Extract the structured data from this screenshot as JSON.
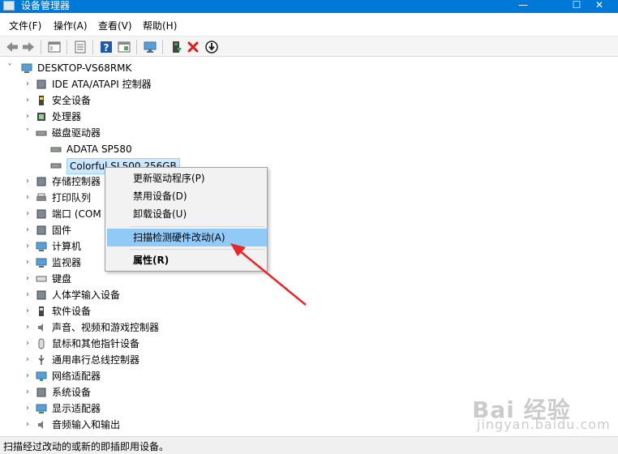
{
  "window": {
    "title": "设备管理器",
    "minimize": "—",
    "maximize": "☐",
    "close": "✕"
  },
  "menu": [
    "文件(F)",
    "操作(A)",
    "查看(V)",
    "帮助(H)"
  ],
  "toolbar_icons": [
    "back-icon",
    "forward-icon",
    "properties-panel-icon",
    "details-icon",
    "help-icon",
    "show-hidden-icon",
    "monitor-icon",
    "add-driver-icon",
    "uninstall-icon",
    "update-driver-icon"
  ],
  "tree": {
    "root": "DESKTOP-VS68RMK",
    "items": [
      {
        "label": "IDE ATA/ATAPI 控制器",
        "icon": "ide-controller-icon",
        "expanded": false
      },
      {
        "label": "安全设备",
        "icon": "security-device-icon",
        "expanded": false
      },
      {
        "label": "处理器",
        "icon": "processor-icon",
        "expanded": false
      },
      {
        "label": "磁盘驱动器",
        "icon": "disk-drive-icon",
        "expanded": true
      },
      {
        "label": "ADATA SP580",
        "icon": "disk-icon",
        "child": true
      },
      {
        "label": "Colorful SL500 256GB",
        "icon": "disk-icon",
        "child": true,
        "selected": true
      },
      {
        "label": "存储控制器",
        "icon": "storage-controller-icon",
        "expanded": false
      },
      {
        "label": "打印队列",
        "icon": "printer-icon",
        "expanded": false
      },
      {
        "label": "端口 (COM",
        "icon": "port-icon",
        "expanded": false
      },
      {
        "label": "固件",
        "icon": "firmware-icon",
        "expanded": false
      },
      {
        "label": "计算机",
        "icon": "computer-icon",
        "expanded": false
      },
      {
        "label": "监视器",
        "icon": "monitor-icon",
        "expanded": false
      },
      {
        "label": "键盘",
        "icon": "keyboard-icon",
        "expanded": false
      },
      {
        "label": "人体学输入设备",
        "icon": "hid-icon",
        "expanded": false
      },
      {
        "label": "软件设备",
        "icon": "software-device-icon",
        "expanded": false
      },
      {
        "label": "声音、视频和游戏控制器",
        "icon": "sound-icon",
        "expanded": false
      },
      {
        "label": "鼠标和其他指针设备",
        "icon": "mouse-icon",
        "expanded": false
      },
      {
        "label": "通用串行总线控制器",
        "icon": "usb-icon",
        "expanded": false
      },
      {
        "label": "网络适配器",
        "icon": "network-adapter-icon",
        "expanded": false
      },
      {
        "label": "系统设备",
        "icon": "system-device-icon",
        "expanded": false
      },
      {
        "label": "显示适配器",
        "icon": "display-adapter-icon",
        "expanded": false
      },
      {
        "label": "音频输入和输出",
        "icon": "audio-io-icon",
        "expanded": false
      }
    ]
  },
  "context_menu": {
    "items": [
      "更新驱动程序(P)",
      "禁用设备(D)",
      "卸载设备(U)",
      "扫描检测硬件改动(A)",
      "属性(R)"
    ],
    "highlighted": "扫描检测硬件改动(A)"
  },
  "status": "扫描经过改动的或新的即插即用设备。",
  "watermark": {
    "text": "Bai 经验",
    "sub": "jingyan.baidu.com"
  },
  "colors": {
    "titlebar": "#0078d7",
    "selection": "#cce8ff",
    "menu_highlight": "#91c9f7",
    "annotation_arrow": "#e8262b"
  }
}
